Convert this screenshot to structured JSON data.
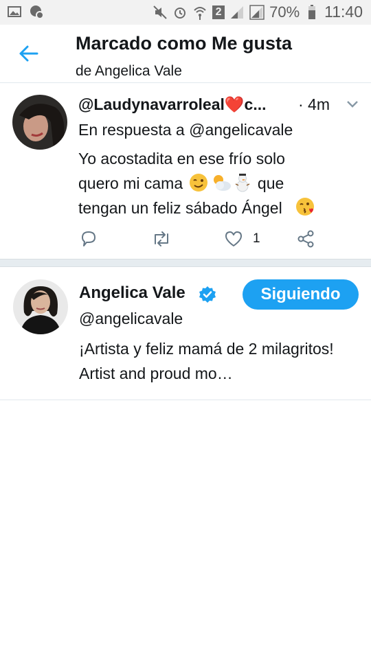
{
  "status_bar": {
    "battery": "70%",
    "time": "11:40",
    "sim_badge": "2",
    "icons": [
      "image-icon",
      "shield-icon",
      "mute-icon",
      "alarm-icon",
      "wifi-icon",
      "signal-icon",
      "signal-icon",
      "battery-icon"
    ]
  },
  "header": {
    "title": "Marcado como Me gusta",
    "subtitle": "de Angelica Vale"
  },
  "tweet": {
    "handle": "@Laudynavarroleal❤️c...",
    "time": "· 4m",
    "reply_to": "En respuesta a @angelicavale",
    "text_line1": "Yo acostadita en ese frío solo",
    "text_line2a": "quero mi cama",
    "text_line2b": "que",
    "text_line3": "tengan un feliz sábado Ángel",
    "like_count": "1",
    "icons": [
      "reply-icon",
      "retweet-icon",
      "like-icon",
      "share-icon",
      "chevron-down-icon"
    ]
  },
  "user": {
    "name": "Angelica Vale",
    "handle": "@angelicavale",
    "follow_label": "Siguiendo",
    "bio": "¡Artista y feliz mamá de 2 milagritos! Artist and proud mo…"
  },
  "colors": {
    "accent": "#1da1f2",
    "text": "#14171a",
    "icon_gray": "#657786"
  }
}
